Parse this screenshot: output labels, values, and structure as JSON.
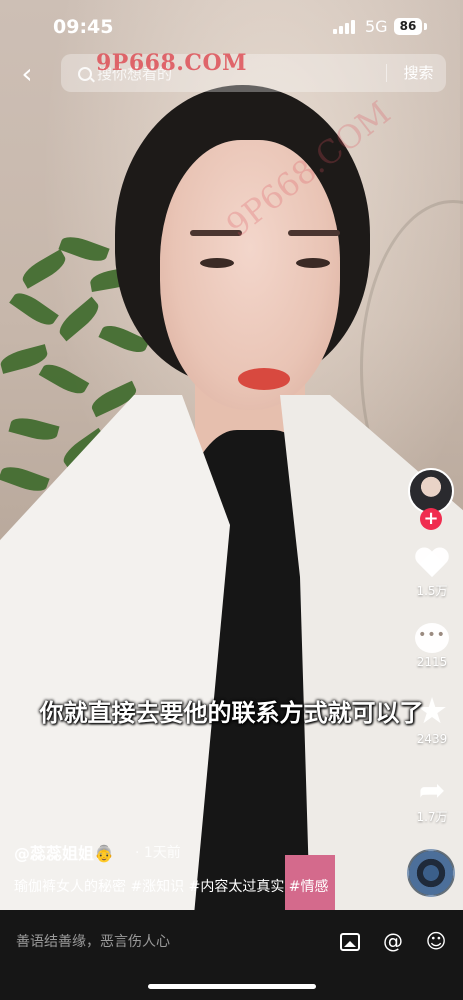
{
  "status_bar": {
    "time": "09:45",
    "network": "5G",
    "battery": "86"
  },
  "search": {
    "placeholder": "搜你想看的",
    "button_label": "搜索"
  },
  "watermark": {
    "text": "9P668.COM"
  },
  "subtitle": "你就直接去要他的联系方式就可以了",
  "author": {
    "name": "@蕊蕊姐姐",
    "emoji": "👵",
    "time_ago": "· 1天前"
  },
  "caption": "瑜伽裤女人的秘密 #涨知识 #内容太过真实 #情感",
  "rail": {
    "likes": "1.5万",
    "comments": "2115",
    "favorites": "2439",
    "shares": "1.7万",
    "follow_symbol": "+"
  },
  "comment_bar": {
    "placeholder": "善语结善缘，恶言伤人心"
  },
  "colors": {
    "accent": "#f02c4f",
    "bottom_bar": "#161616"
  },
  "icons": [
    "back-icon",
    "search-icon",
    "heart-icon",
    "comment-icon",
    "star-icon",
    "share-icon",
    "image-icon",
    "at-icon",
    "emoji-icon"
  ]
}
